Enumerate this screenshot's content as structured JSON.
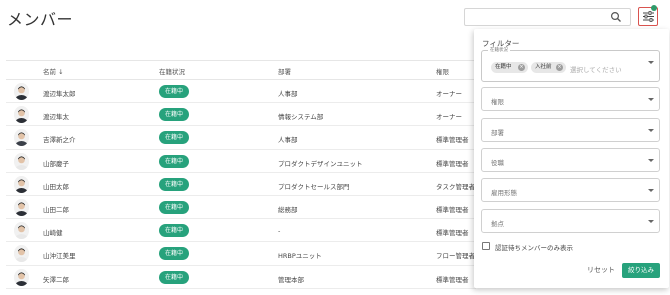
{
  "page": {
    "title": "メンバー"
  },
  "search": {
    "placeholder": "",
    "icon": "search-icon"
  },
  "colors": {
    "accent": "#27a27c",
    "filter_border": "#d9534f",
    "filter_dot": "#2e9a6a"
  },
  "table": {
    "columns": [
      {
        "key": "name",
        "label": "名前 ↓"
      },
      {
        "key": "status",
        "label": "在籍状況"
      },
      {
        "key": "dept",
        "label": "部署"
      },
      {
        "key": "role",
        "label": "権限"
      }
    ],
    "rows": [
      {
        "name": "渡辺隼太郎",
        "status": "在籍中",
        "dept": "人事部",
        "role": "オーナー"
      },
      {
        "name": "渡辺隼太",
        "status": "在籍中",
        "dept": "情報システム部",
        "role": "オーナー"
      },
      {
        "name": "吉澤新之介",
        "status": "在籍中",
        "dept": "人事部",
        "role": "標準管理者"
      },
      {
        "name": "山部慶子",
        "status": "在籍中",
        "dept": "プロダクトデザインユニット",
        "role": "標準管理者"
      },
      {
        "name": "山田太郎",
        "status": "在籍中",
        "dept": "プロダクトセールス部門",
        "role": "タスク管理者"
      },
      {
        "name": "山田二郎",
        "status": "在籍中",
        "dept": "総務部",
        "role": "標準管理者"
      },
      {
        "name": "山崎健",
        "status": "在籍中",
        "dept": "-",
        "role": "標準管理者"
      },
      {
        "name": "山沖江美里",
        "status": "在籍中",
        "dept": "HRBPユニット",
        "role": "フロー管理者"
      },
      {
        "name": "矢澤二郎",
        "status": "在籍中",
        "dept": "管理本部",
        "role": "標準管理者"
      }
    ]
  },
  "filter": {
    "title": "フィルター",
    "status": {
      "legend": "在籍状況",
      "chips": [
        "在籍中",
        "入社前"
      ],
      "placeholder": "選択してください"
    },
    "selects": [
      "権限",
      "部署",
      "役職",
      "雇用形態",
      "拠点"
    ],
    "checkbox_label": "認証待ちメンバーのみ表示",
    "reset_label": "リセット",
    "apply_label": "絞り込み"
  }
}
